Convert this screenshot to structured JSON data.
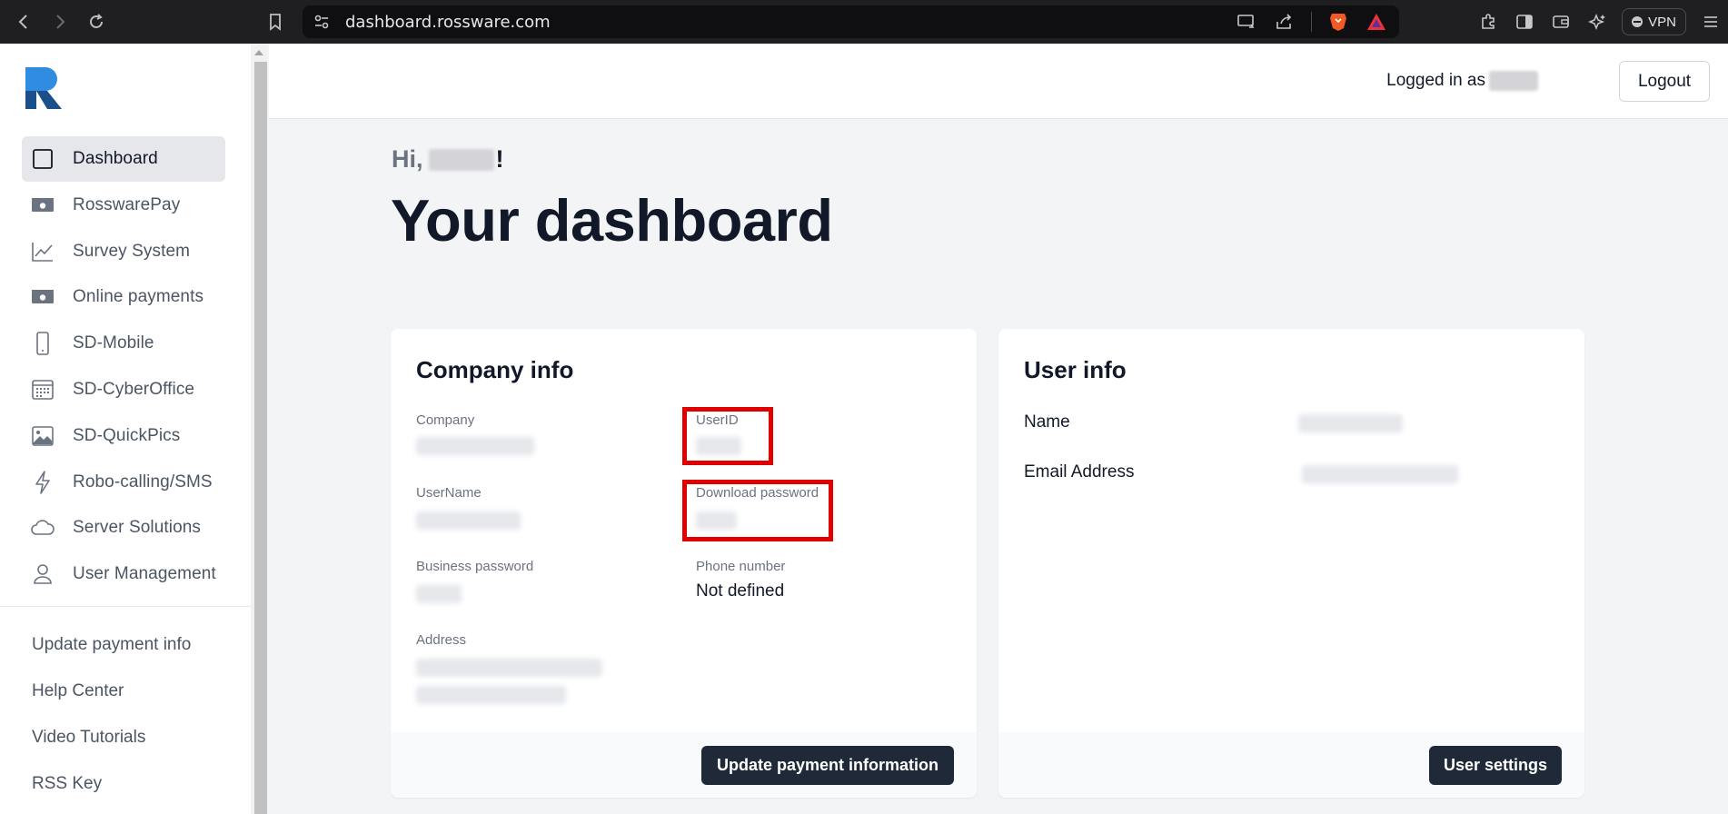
{
  "browser": {
    "url": "dashboard.rossware.com",
    "vpn_label": "VPN"
  },
  "sidebar": {
    "items": [
      {
        "label": "Dashboard",
        "icon": "square-icon",
        "active": true
      },
      {
        "label": "RosswarePay",
        "icon": "cash-icon"
      },
      {
        "label": "Survey System",
        "icon": "trend-chart-icon"
      },
      {
        "label": "Online payments",
        "icon": "cash-icon"
      },
      {
        "label": "SD-Mobile",
        "icon": "phone-icon"
      },
      {
        "label": "SD-CyberOffice",
        "icon": "calendar-icon"
      },
      {
        "label": "SD-QuickPics",
        "icon": "image-icon"
      },
      {
        "label": "Robo-calling/SMS",
        "icon": "lightning-icon"
      },
      {
        "label": "Server Solutions",
        "icon": "cloud-icon"
      },
      {
        "label": "User Management",
        "icon": "user-icon"
      }
    ],
    "bottom_links": [
      "Update payment info",
      "Help Center",
      "Video Tutorials",
      "RSS Key"
    ]
  },
  "header": {
    "logged_in_label": "Logged in as",
    "logout_label": "Logout"
  },
  "main": {
    "greeting_prefix": "Hi,",
    "greeting_suffix": "!",
    "title": "Your dashboard"
  },
  "company_card": {
    "title": "Company info",
    "fields": {
      "company": "Company",
      "userid": "UserID",
      "username": "UserName",
      "download_password": "Download password",
      "business_password": "Business password",
      "phone_number": "Phone number",
      "phone_value": "Not defined",
      "address": "Address"
    },
    "button": "Update payment information"
  },
  "user_card": {
    "title": "User info",
    "name_label": "Name",
    "email_label": "Email Address",
    "button": "User settings"
  },
  "colors": {
    "highlight": "#e00000",
    "button_dark": "#1f2937",
    "logo_light": "#2f8ce0",
    "logo_dark": "#1b4f8a"
  }
}
